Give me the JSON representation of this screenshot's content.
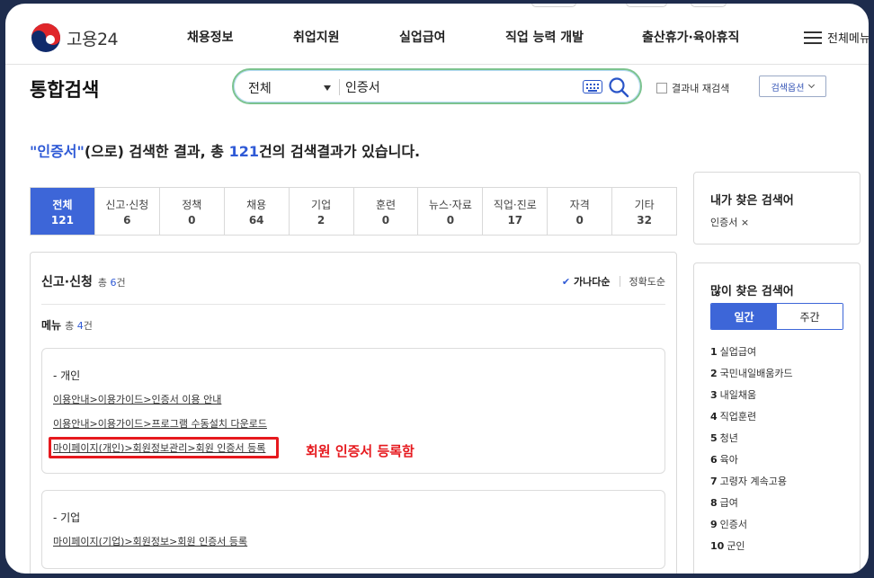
{
  "header": {
    "logo_text": "고용24",
    "nav": [
      "채용정보",
      "취업지원",
      "실업급여",
      "직업 능력 개발",
      "출산휴가·육아휴직"
    ],
    "menu_all": "전체메뉴"
  },
  "search": {
    "page_title": "통합검색",
    "scope": "전체",
    "query": "인증서",
    "recheck_label": "결과내 재검색",
    "option_button": "검색옵션"
  },
  "summary": {
    "keyword": "\"인증서\"",
    "mid": "(으로) 검색한 결과, 총 ",
    "count": "121",
    "tail": "건의 검색결과가 있습니다."
  },
  "categories": [
    {
      "label": "전체",
      "count": "121"
    },
    {
      "label": "신고·신청",
      "count": "6"
    },
    {
      "label": "정책",
      "count": "0"
    },
    {
      "label": "채용",
      "count": "64"
    },
    {
      "label": "기업",
      "count": "2"
    },
    {
      "label": "훈련",
      "count": "0"
    },
    {
      "label": "뉴스·자료",
      "count": "0"
    },
    {
      "label": "직업·진로",
      "count": "17"
    },
    {
      "label": "자격",
      "count": "0"
    },
    {
      "label": "기타",
      "count": "32"
    }
  ],
  "results": {
    "section_title": "신고·신청",
    "section_total_prefix": "총 ",
    "section_total_num": "6",
    "section_total_suffix": "건",
    "sort_active": "가나다순",
    "sort_other": "정확도순",
    "sub_title": "메뉴",
    "sub_total_prefix": "총 ",
    "sub_total_num": "4",
    "sub_total_suffix": "건",
    "personal_head": "- 개인",
    "personal_links": [
      "이용안내>이용가이드>인증서 이용 안내",
      "이용안내>이용가이드>프로그램 수동설치 다운로드",
      "마이페이지(개인)>회원정보관리>회원 인증서 등록"
    ],
    "company_head": "- 기업",
    "company_links": [
      "마이페이지(기업)>회원정보>회원 인증서 등록"
    ],
    "annotation": "회원 인증서 등록함"
  },
  "sidebar": {
    "my_title": "내가 찾은 검색어",
    "my_keyword": "인증서 ×",
    "popular_title": "많이 찾은 검색어",
    "tab_daily": "일간",
    "tab_weekly": "주간",
    "popular": [
      {
        "rank": "1",
        "term": "실업급여"
      },
      {
        "rank": "2",
        "term": "국민내일배움카드"
      },
      {
        "rank": "3",
        "term": "내일채움"
      },
      {
        "rank": "4",
        "term": "직업훈련"
      },
      {
        "rank": "5",
        "term": "청년"
      },
      {
        "rank": "6",
        "term": "육아"
      },
      {
        "rank": "7",
        "term": "고령자 계속고용"
      },
      {
        "rank": "8",
        "term": "급여"
      },
      {
        "rank": "9",
        "term": "인증서"
      },
      {
        "rank": "10",
        "term": "군인"
      }
    ]
  },
  "colors": {
    "accent": "#3d66d8",
    "highlight": "#e6191e",
    "search_border": "#7cc38f",
    "frame": "#1e2c4d"
  }
}
